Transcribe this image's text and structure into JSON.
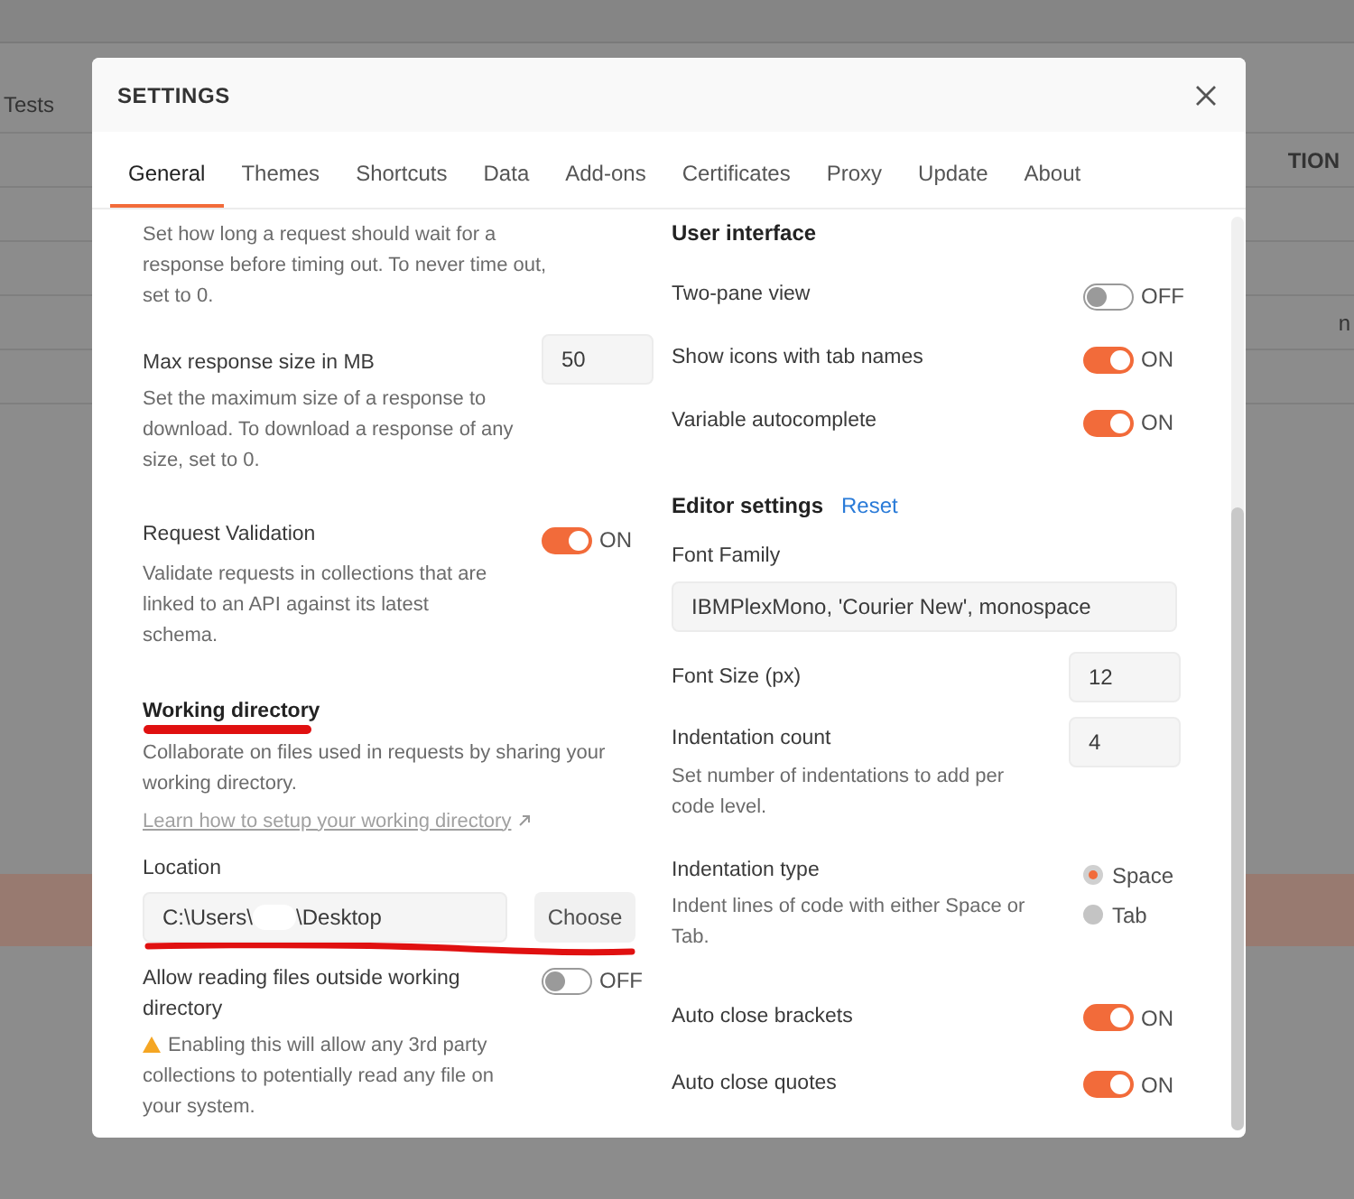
{
  "background": {
    "tab_label": "Tests",
    "column_heading": "TION",
    "cell_text": "n"
  },
  "dialog": {
    "title": "SETTINGS",
    "tabs": [
      {
        "label": "General",
        "selected": true
      },
      {
        "label": "Themes",
        "selected": false
      },
      {
        "label": "Shortcuts",
        "selected": false
      },
      {
        "label": "Data",
        "selected": false
      },
      {
        "label": "Add-ons",
        "selected": false
      },
      {
        "label": "Certificates",
        "selected": false
      },
      {
        "label": "Proxy",
        "selected": false
      },
      {
        "label": "Update",
        "selected": false
      },
      {
        "label": "About",
        "selected": false
      }
    ],
    "left": {
      "timeout_description": "Set how long a request should wait for a response before timing out. To never time out, set to 0.",
      "max_size": {
        "label": "Max response size in MB",
        "value": "50",
        "description": "Set the maximum size of a response to download. To download a response of any size, set to 0."
      },
      "validation": {
        "label": "Request Validation",
        "on": true,
        "state_text": "ON",
        "description": "Validate requests in collections that are linked to an API against its latest schema."
      },
      "working_directory": {
        "heading": "Working directory",
        "description": "Collaborate on files used in requests by sharing your working directory.",
        "link": "Learn how to setup your working directory",
        "location_label": "Location",
        "path_start": "C:\\Users\\",
        "path_end": "\\Desktop",
        "choose_button": "Choose"
      },
      "outside_files": {
        "label": "Allow reading files outside working directory",
        "on": false,
        "state_text": "OFF",
        "warning": "Enabling this will allow any 3rd party collections to potentially read any file on your system."
      }
    },
    "right": {
      "ui_heading": "User interface",
      "ui_toggles": [
        {
          "label": "Two-pane view",
          "on": false,
          "state_text": "OFF"
        },
        {
          "label": "Show icons with tab names",
          "on": true,
          "state_text": "ON"
        },
        {
          "label": "Variable autocomplete",
          "on": true,
          "state_text": "ON"
        }
      ],
      "editor_heading": "Editor settings",
      "reset_link": "Reset",
      "font_family": {
        "label": "Font Family",
        "value": "IBMPlexMono, 'Courier New', monospace"
      },
      "font_size": {
        "label": "Font Size (px)",
        "value": "12"
      },
      "indent_count": {
        "label": "Indentation count",
        "value": "4",
        "description": "Set number of indentations to add per code level."
      },
      "indent_type": {
        "label": "Indentation type",
        "description": "Indent lines of code with either Space or Tab.",
        "options": [
          {
            "label": "Space",
            "selected": true
          },
          {
            "label": "Tab",
            "selected": false
          }
        ]
      },
      "bottom_toggles": [
        {
          "label": "Auto close brackets",
          "on": true,
          "state_text": "ON"
        },
        {
          "label": "Auto close quotes",
          "on": true,
          "state_text": "ON"
        }
      ]
    }
  }
}
